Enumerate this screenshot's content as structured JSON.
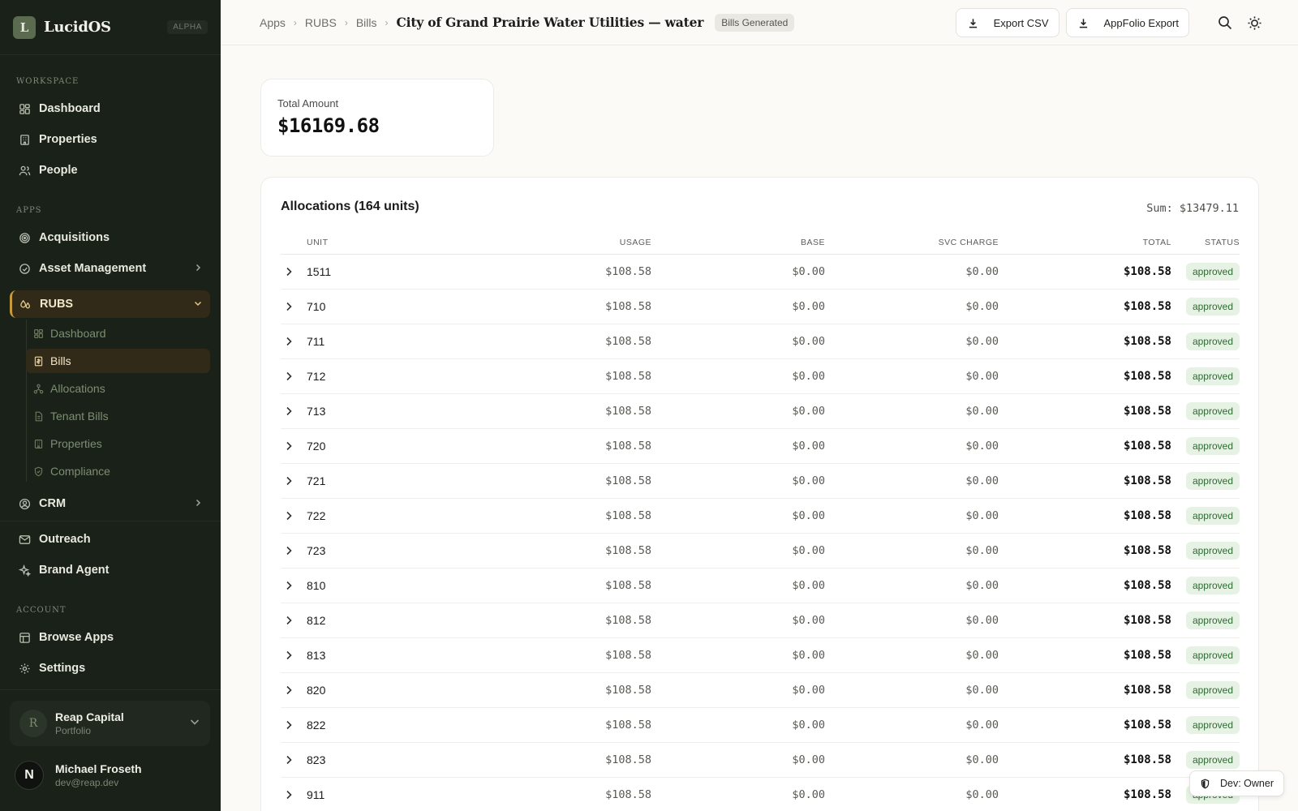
{
  "brand": {
    "logo_letter": "L",
    "name": "LucidOS",
    "tag": "ALPHA"
  },
  "sidebar": {
    "workspace_label": "WORKSPACE",
    "workspace_items": [
      {
        "label": "Dashboard",
        "icon": "grid-icon"
      },
      {
        "label": "Properties",
        "icon": "building-icon"
      },
      {
        "label": "People",
        "icon": "users-icon"
      }
    ],
    "apps_label": "APPS",
    "apps_items": [
      {
        "label": "Acquisitions",
        "icon": "target-icon"
      },
      {
        "label": "Asset Management",
        "icon": "gauge-icon"
      },
      {
        "label": "RUBS",
        "icon": "droplets-icon",
        "expanded": true
      },
      {
        "label": "CRM",
        "icon": "user-circle-icon"
      },
      {
        "label": "Outreach",
        "icon": "mail-icon"
      },
      {
        "label": "Brand Agent",
        "icon": "sparkle-icon"
      }
    ],
    "rubs_sub": [
      {
        "label": "Dashboard",
        "icon": "grid-icon"
      },
      {
        "label": "Bills",
        "icon": "receipt-icon",
        "active": true
      },
      {
        "label": "Allocations",
        "icon": "network-icon"
      },
      {
        "label": "Tenant Bills",
        "icon": "file-icon"
      },
      {
        "label": "Properties",
        "icon": "building-icon"
      },
      {
        "label": "Compliance",
        "icon": "shield-check-icon"
      }
    ],
    "account_label": "ACCOUNT",
    "account_items": [
      {
        "label": "Browse Apps",
        "icon": "layout-icon"
      },
      {
        "label": "Settings",
        "icon": "gear-icon"
      }
    ],
    "org": {
      "avatar": "R",
      "name": "Reap Capital",
      "sub": "Portfolio"
    },
    "user": {
      "avatar": "N",
      "name": "Michael Froseth",
      "email": "dev@reap.dev"
    }
  },
  "header": {
    "breadcrumbs": [
      "Apps",
      "RUBS",
      "Bills"
    ],
    "title": "City of Grand Prairie Water Utilities — water",
    "status_badge": "Bills Generated",
    "export_csv_label": "Export CSV",
    "appfolio_label": "AppFolio Export"
  },
  "summary": {
    "total_label": "Total Amount",
    "total_value": "$16169.68"
  },
  "allocations": {
    "title": "Allocations (164 units)",
    "sum": "Sum: $13479.11",
    "columns": [
      "UNIT",
      "USAGE",
      "BASE",
      "SVC CHARGE",
      "TOTAL",
      "STATUS"
    ],
    "rows": [
      {
        "unit": "1511",
        "usage": "$108.58",
        "base": "$0.00",
        "svc": "$0.00",
        "total": "$108.58",
        "status": "approved"
      },
      {
        "unit": "710",
        "usage": "$108.58",
        "base": "$0.00",
        "svc": "$0.00",
        "total": "$108.58",
        "status": "approved"
      },
      {
        "unit": "711",
        "usage": "$108.58",
        "base": "$0.00",
        "svc": "$0.00",
        "total": "$108.58",
        "status": "approved"
      },
      {
        "unit": "712",
        "usage": "$108.58",
        "base": "$0.00",
        "svc": "$0.00",
        "total": "$108.58",
        "status": "approved"
      },
      {
        "unit": "713",
        "usage": "$108.58",
        "base": "$0.00",
        "svc": "$0.00",
        "total": "$108.58",
        "status": "approved"
      },
      {
        "unit": "720",
        "usage": "$108.58",
        "base": "$0.00",
        "svc": "$0.00",
        "total": "$108.58",
        "status": "approved"
      },
      {
        "unit": "721",
        "usage": "$108.58",
        "base": "$0.00",
        "svc": "$0.00",
        "total": "$108.58",
        "status": "approved"
      },
      {
        "unit": "722",
        "usage": "$108.58",
        "base": "$0.00",
        "svc": "$0.00",
        "total": "$108.58",
        "status": "approved"
      },
      {
        "unit": "723",
        "usage": "$108.58",
        "base": "$0.00",
        "svc": "$0.00",
        "total": "$108.58",
        "status": "approved"
      },
      {
        "unit": "810",
        "usage": "$108.58",
        "base": "$0.00",
        "svc": "$0.00",
        "total": "$108.58",
        "status": "approved"
      },
      {
        "unit": "812",
        "usage": "$108.58",
        "base": "$0.00",
        "svc": "$0.00",
        "total": "$108.58",
        "status": "approved"
      },
      {
        "unit": "813",
        "usage": "$108.58",
        "base": "$0.00",
        "svc": "$0.00",
        "total": "$108.58",
        "status": "approved"
      },
      {
        "unit": "820",
        "usage": "$108.58",
        "base": "$0.00",
        "svc": "$0.00",
        "total": "$108.58",
        "status": "approved"
      },
      {
        "unit": "822",
        "usage": "$108.58",
        "base": "$0.00",
        "svc": "$0.00",
        "total": "$108.58",
        "status": "approved"
      },
      {
        "unit": "823",
        "usage": "$108.58",
        "base": "$0.00",
        "svc": "$0.00",
        "total": "$108.58",
        "status": "approved"
      },
      {
        "unit": "911",
        "usage": "$108.58",
        "base": "$0.00",
        "svc": "$0.00",
        "total": "$108.58",
        "status": "approved"
      }
    ]
  },
  "dev_badge": "Dev: Owner",
  "colors": {
    "sidebar_bg": "#1a2119",
    "accent": "#c79a3c",
    "active_bg": "#322a18",
    "status_green": "#2d6a31"
  }
}
